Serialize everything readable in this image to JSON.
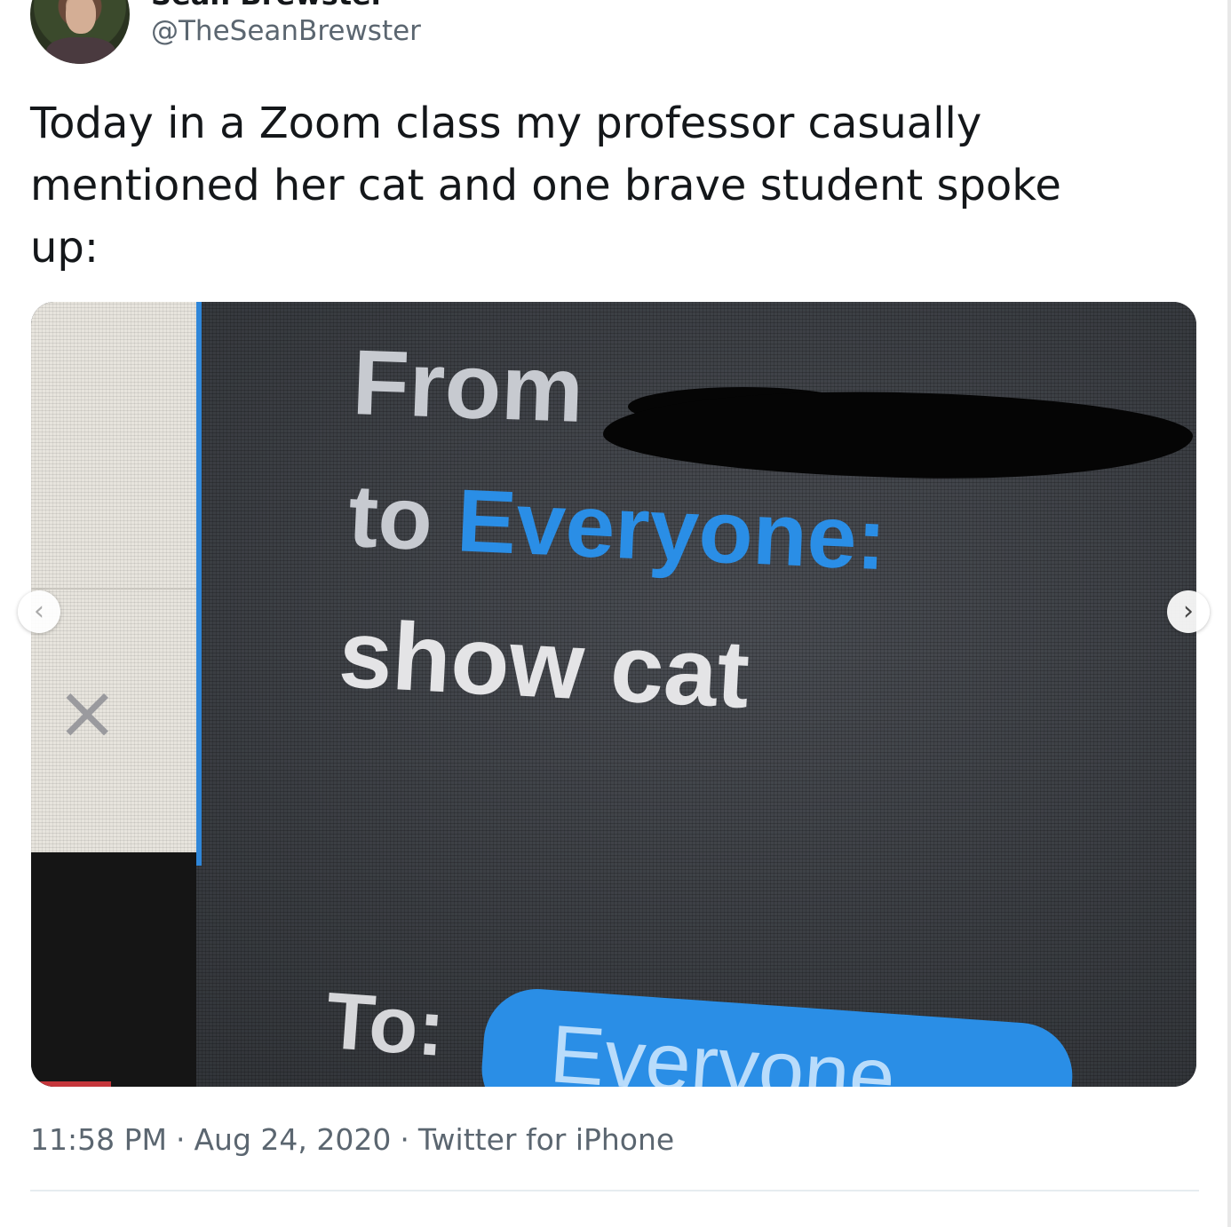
{
  "author": {
    "display_name": "Sean Brewster",
    "handle": "@TheSeanBrewster",
    "avatar_icon": "profile-photo"
  },
  "tweet": {
    "text": "Today in a Zoom class my professor casually\nmentioned her cat and one brave student spoke\nup:"
  },
  "media": {
    "chat": {
      "from_label": "From",
      "to_prefix": "to",
      "recipient": "Everyone:",
      "message": "show cat",
      "compose_to_label": "To:",
      "compose_to_value": "Everyone"
    },
    "close_icon": "close-icon",
    "accent_color": "#2a8ee6"
  },
  "carousel": {
    "prev_icon": "chevron-left-icon",
    "next_icon": "chevron-right-icon",
    "prev_glyph": "‹",
    "next_glyph": "›"
  },
  "meta": {
    "time": "11:58 PM",
    "date": "Aug 24, 2020",
    "source": "Twitter for iPhone",
    "separator": "·"
  }
}
